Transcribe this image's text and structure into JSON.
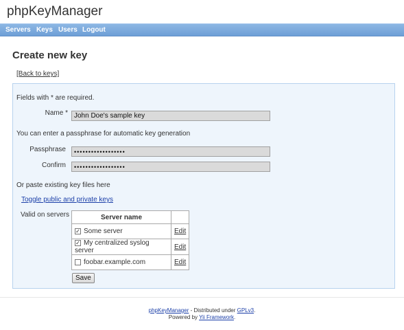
{
  "app": {
    "title": "phpKeyManager"
  },
  "menu": {
    "items": [
      "Servers",
      "Keys",
      "Users",
      "Logout"
    ]
  },
  "page": {
    "heading": "Create new key",
    "back_link": "[Back to keys]"
  },
  "form": {
    "required_note": "Fields with * are required.",
    "name_label": "Name *",
    "name_value": "John Doe's sample key",
    "passphrase_note": "You can enter a passphrase for automatic key generation",
    "passphrase_label": "Passphrase",
    "passphrase_value": "••••••••••••••••••",
    "confirm_label": "Confirm",
    "confirm_value": "••••••••••••••••••",
    "paste_note": "Or paste existing key files here",
    "toggle_link": "Toggle public and private keys",
    "servers_label": "Valid on servers",
    "server_table": {
      "header": "Server name",
      "rows": [
        {
          "name": "Some server",
          "checked": true,
          "edit": "Edit"
        },
        {
          "name": "My centralized syslog server",
          "checked": true,
          "edit": "Edit"
        },
        {
          "name": "foobar.example.com",
          "checked": false,
          "edit": "Edit"
        }
      ]
    },
    "save_label": "Save"
  },
  "footer": {
    "app_link": "phpKeyManager",
    "distributed_text": " - Distributed under ",
    "license_link": "GPLv3",
    "period": ".",
    "powered_text": "Powered by ",
    "framework_link": "Yii Framework",
    "period2": "."
  }
}
